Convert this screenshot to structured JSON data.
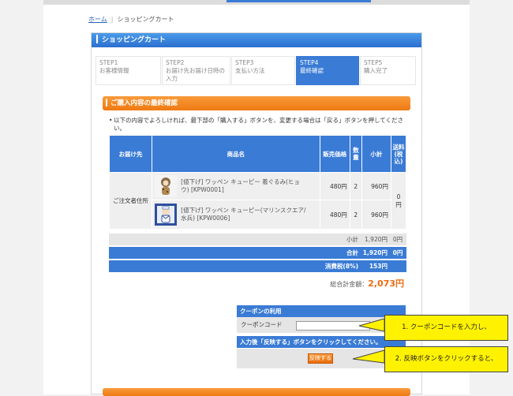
{
  "breadcrumb": {
    "home": "ホーム",
    "current": "ショッピングカート"
  },
  "cart": {
    "title": "ショッピングカート"
  },
  "steps": [
    {
      "num": "STEP1",
      "label": "お客様情報",
      "active": false
    },
    {
      "num": "STEP2",
      "label": "お届け先お届け日時の入力",
      "active": false
    },
    {
      "num": "STEP3",
      "label": "支払い方法",
      "active": false
    },
    {
      "num": "STEP4",
      "label": "最終確認",
      "active": true
    },
    {
      "num": "STEP5",
      "label": "購入完了",
      "active": false
    }
  ],
  "confirm": {
    "title": "ご購入内容の最終確認",
    "notice": "以下の内容でよろしければ、最下部の「購入する」ボタンを、変更する場合は「戻る」ボタンを押してください。"
  },
  "table": {
    "headers": {
      "dest": "お届け先",
      "product": "商品名",
      "price": "販売価格",
      "qty": "数量",
      "subtotal": "小計",
      "shipping": "送料(税込)"
    },
    "dest": "ご注文者住所",
    "shipping_value": "0円",
    "rows": [
      {
        "name": "[値下げ] ワッペン キューピー 着ぐるみ(ヒョウ) [KPW0001]",
        "price": "480円",
        "qty": "2",
        "subtotal": "960円"
      },
      {
        "name": "[値下げ] ワッペン キューピー(マリンスクエア/水兵) [KPW0006]",
        "price": "480円",
        "qty": "2",
        "subtotal": "960円"
      }
    ]
  },
  "summary": {
    "subtotal_label": "小計",
    "subtotal": "1,920円",
    "subtotal_ship": "0円",
    "total_label": "合計",
    "total": "1,920円",
    "total_ship": "0円",
    "tax_label": "消費税(8%)",
    "tax": "153円"
  },
  "grand": {
    "label": "総合計金額：",
    "amount": "2,073円"
  },
  "coupon": {
    "title": "クーポンの利用",
    "label": "クーポンコード",
    "value": "",
    "note": "入力後「反映する」ボタンをクリックしてください。",
    "button": "反映する"
  },
  "callouts": {
    "first": "1. クーポンコードを入力し、",
    "second": "2. 反映ボタンをクリックすると、"
  },
  "colors": {
    "blue": "#3a7bd5",
    "orange": "#ee7a12",
    "callout": "#fff200",
    "price_accent": "#ee6a0e"
  }
}
